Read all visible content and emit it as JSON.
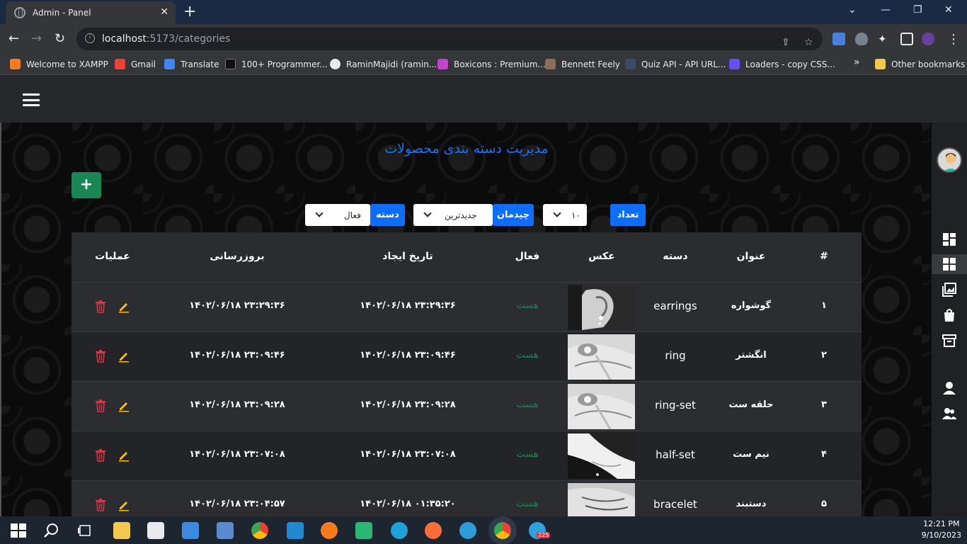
{
  "browser": {
    "tab_title": "Admin - Panel",
    "close_glyph": "✕",
    "newtab_glyph": "+",
    "url_host": "localhost",
    "url_path": ":5173/categories",
    "bookmarks": [
      {
        "label": "Welcome to XAMPP",
        "color": "#fb7a24"
      },
      {
        "label": "Gmail",
        "color": "#ea4335"
      },
      {
        "label": "Translate",
        "color": "#4285f4"
      },
      {
        "label": "100+ Programmer...",
        "color": "#111111"
      },
      {
        "label": "RaminMajidi (ramin...",
        "color": "#e8eaed"
      },
      {
        "label": "Boxicons : Premium...",
        "color": "#c93fce"
      },
      {
        "label": "Bennett Feely",
        "color": "#8a6d5a"
      },
      {
        "label": "Quiz API - API URL...",
        "color": "#3b4a6b"
      },
      {
        "label": "Loaders - copy CSS...",
        "color": "#6c4cff"
      }
    ],
    "overflow_glyph": "»",
    "other_bookmarks": "Other bookmarks"
  },
  "page": {
    "title": "مدیریت دسته بندی محصولات",
    "add_glyph": "+"
  },
  "filters": {
    "count_label": "تعداد",
    "count_value": "۱۰",
    "sort_label": "چیدمان",
    "sort_value": "جدیدترین",
    "category_label": "دسته",
    "category_value": "فعال"
  },
  "table": {
    "headers": {
      "index": "#",
      "title": "عنوان",
      "category": "دسته",
      "image": "عکس",
      "active": "فعال",
      "created": "تاریخ ایجاد",
      "updated": "بروزرسانی",
      "ops": "عملیات"
    },
    "rows": [
      {
        "index": "۱",
        "title": "گوشواره",
        "slug": "earrings",
        "active": "هست",
        "created": "۱۴۰۲/۰۶/۱۸ ۲۳:۲۹:۳۶",
        "updated": "۱۴۰۲/۰۶/۱۸ ۲۳:۲۹:۳۶"
      },
      {
        "index": "۲",
        "title": "انگشتر",
        "slug": "ring",
        "active": "هست",
        "created": "۱۴۰۲/۰۶/۱۸ ۲۳:۰۹:۴۶",
        "updated": "۱۴۰۲/۰۶/۱۸ ۲۳:۰۹:۴۶"
      },
      {
        "index": "۳",
        "title": "حلقه ست",
        "slug": "ring-set",
        "active": "هست",
        "created": "۱۴۰۲/۰۶/۱۸ ۲۳:۰۹:۲۸",
        "updated": "۱۴۰۲/۰۶/۱۸ ۲۳:۰۹:۲۸"
      },
      {
        "index": "۴",
        "title": "نیم ست",
        "slug": "half-set",
        "active": "هست",
        "created": "۱۴۰۲/۰۶/۱۸ ۲۳:۰۷:۰۸",
        "updated": "۱۴۰۲/۰۶/۱۸ ۲۳:۰۷:۰۸"
      },
      {
        "index": "۵",
        "title": "دستبند",
        "slug": "bracelet",
        "active": "هست",
        "created": "۱۴۰۲/۰۶/۱۸ ۰۱:۳۵:۲۰",
        "updated": "۱۴۰۲/۰۶/۱۸ ۲۳:۰۴:۵۷"
      }
    ]
  },
  "taskbar": {
    "time": "12:21 PM",
    "date": "9/10/2023",
    "telegram_badge": "225"
  },
  "colors": {
    "accent": "#0d6efd",
    "success": "#198754",
    "danger": "#dc3545",
    "warning": "#ffc107"
  }
}
